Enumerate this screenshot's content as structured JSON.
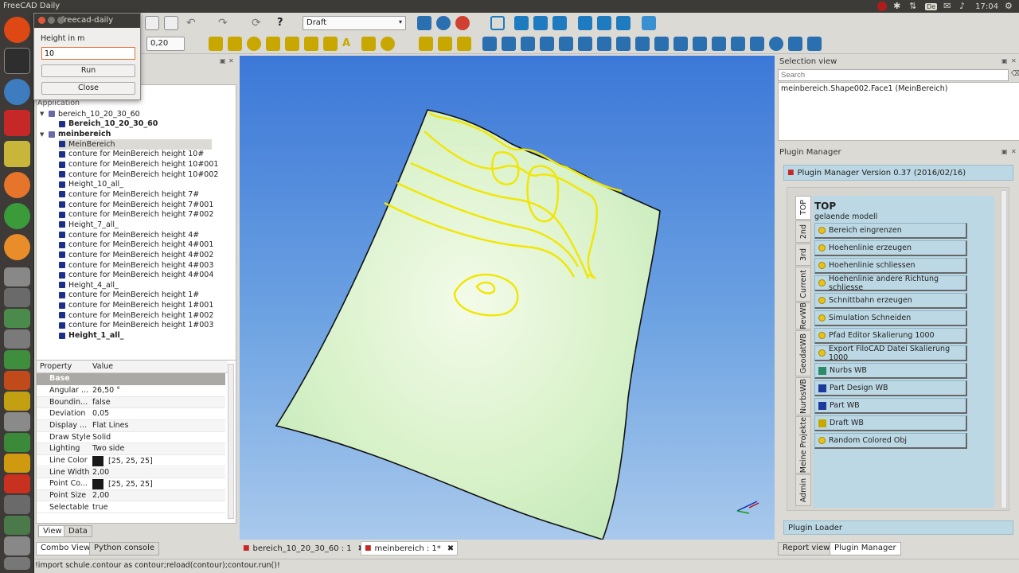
{
  "os": {
    "window_title": "FreeCAD Daily",
    "time": "17:04",
    "keyboard_layout": "De"
  },
  "dialog": {
    "title": "freecad-daily",
    "label": "Height in m",
    "input_value": "10",
    "run_label": "Run",
    "close_label": "Close"
  },
  "toolbar": {
    "workbench": "Draft",
    "spin_value": "0,20"
  },
  "tree": {
    "header": "Application",
    "items": [
      {
        "label": "bereich_10_20_30_60",
        "bold": false,
        "expanded": true,
        "level": 0
      },
      {
        "label": "Bereich_10_20_30_60",
        "bold": true,
        "level": 1
      },
      {
        "label": "meinbereich",
        "bold": true,
        "expanded": true,
        "level": 0
      },
      {
        "label": "MeinBereich",
        "bold": false,
        "level": 1,
        "selected": true
      },
      {
        "label": "conture for MeinBereich height 10#",
        "level": 1
      },
      {
        "label": "conture for MeinBereich height 10#001",
        "level": 1
      },
      {
        "label": "conture for MeinBereich height 10#002",
        "level": 1
      },
      {
        "label": "Height_10_all_",
        "level": 1
      },
      {
        "label": "conture for MeinBereich height 7#",
        "level": 1
      },
      {
        "label": "conture for MeinBereich height 7#001",
        "level": 1
      },
      {
        "label": "conture for MeinBereich height 7#002",
        "level": 1
      },
      {
        "label": "Height_7_all_",
        "level": 1
      },
      {
        "label": "conture for MeinBereich height 4#",
        "level": 1
      },
      {
        "label": "conture for MeinBereich height 4#001",
        "level": 1
      },
      {
        "label": "conture for MeinBereich height 4#002",
        "level": 1
      },
      {
        "label": "conture for MeinBereich height 4#003",
        "level": 1
      },
      {
        "label": "conture for MeinBereich height 4#004",
        "level": 1
      },
      {
        "label": "Height_4_all_",
        "level": 1
      },
      {
        "label": "conture for MeinBereich height 1#",
        "level": 1
      },
      {
        "label": "conture for MeinBereich height 1#001",
        "level": 1
      },
      {
        "label": "conture for MeinBereich height 1#002",
        "level": 1
      },
      {
        "label": "conture for MeinBereich height 1#003",
        "level": 1
      },
      {
        "label": "Height_1_all_",
        "bold": true,
        "level": 1
      }
    ]
  },
  "properties": {
    "col_property": "Property",
    "col_value": "Value",
    "group": "Base",
    "rows": [
      {
        "key": "Angular ...",
        "value": "26,50 °"
      },
      {
        "key": "Boundin...",
        "value": "false"
      },
      {
        "key": "Deviation",
        "value": "0,05"
      },
      {
        "key": "Display ...",
        "value": "Flat Lines"
      },
      {
        "key": "Draw Style",
        "value": "Solid"
      },
      {
        "key": "Lighting",
        "value": "Two side"
      },
      {
        "key": "Line Color",
        "value": "[25, 25, 25]",
        "swatch": "#191919"
      },
      {
        "key": "Line Width",
        "value": "2,00"
      },
      {
        "key": "Point Co...",
        "value": "[25, 25, 25]",
        "swatch": "#191919"
      },
      {
        "key": "Point Size",
        "value": "2,00"
      },
      {
        "key": "Selectable",
        "value": "true"
      }
    ],
    "tab_view": "View",
    "tab_data": "Data"
  },
  "bottom_left_tabs": {
    "combo_view": "Combo View",
    "python_console": "Python console"
  },
  "doc_tabs": [
    {
      "label": "bereich_10_20_30_60 : 1"
    },
    {
      "label": "meinbereich : 1*"
    }
  ],
  "status": {
    "text": "!import schule.contour as contour;reload(contour);contour.run()!"
  },
  "selection_view": {
    "title": "Selection view",
    "search_placeholder": "Search",
    "item": "meinbereich.Shape002.Face1 (MeinBereich)"
  },
  "plugin_manager": {
    "title": "Plugin Manager",
    "version": "Plugin Manager Version 0.37  (2016/02/16)",
    "vtabs": [
      "TOP",
      "2nd",
      "3rd",
      "Current",
      "RevWB",
      "GeodatWB",
      "NurbsWB",
      "Meine Projekte",
      "Admin"
    ],
    "section_title": "TOP",
    "section_subtitle": "gelaende modell",
    "items": [
      {
        "label": "Bereich eingrenzen",
        "icon": "bulb-icon"
      },
      {
        "label": "Hoehenlinie erzeugen",
        "icon": "bulb-icon"
      },
      {
        "label": "Hoehenlinie schliessen",
        "icon": "bulb-icon"
      },
      {
        "label": "Hoehenlinie andere Richtung schliesse",
        "icon": "bulb-icon"
      },
      {
        "label": "Schnittbahn erzeugen",
        "icon": "bulb-icon"
      },
      {
        "label": "Simulation Schneiden",
        "icon": "bulb-icon"
      },
      {
        "label": "Pfad Editor Skalierung 1000",
        "icon": "bulb-icon"
      },
      {
        "label": "Export FiloCAD Datei Skalierung 1000",
        "icon": "bulb-icon"
      },
      {
        "label": "Nurbs WB",
        "icon": "grid-icon"
      },
      {
        "label": "Part Design WB",
        "icon": "part-design-icon"
      },
      {
        "label": "Part WB",
        "icon": "part-icon"
      },
      {
        "label": "Draft WB",
        "icon": "draft-icon"
      },
      {
        "label": "Random Colored Obj",
        "icon": "bulb-icon"
      }
    ],
    "loader": "Plugin Loader"
  },
  "bottom_right_tabs": {
    "report_view": "Report view",
    "plugin_manager": "Plugin Manager"
  }
}
